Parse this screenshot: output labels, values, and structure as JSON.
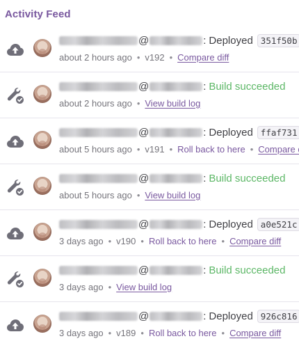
{
  "header": {
    "title": "Activity Feed"
  },
  "colors": {
    "accent": "#79589f",
    "success": "#5cb766",
    "muted": "#75747b",
    "icon": "#6f6e78"
  },
  "feed": {
    "items": [
      {
        "icon": "cloud-upload-icon",
        "user_blurred": true,
        "at": "@",
        "colon": ":",
        "action": "Deployed",
        "hash": "351f50b",
        "time": "about 2 hours ago",
        "version": "v192",
        "link1": "Compare diff",
        "link2": ""
      },
      {
        "icon": "wrench-check-icon",
        "user_blurred": true,
        "at": "@",
        "colon": ":",
        "action": "Build succeeded",
        "hash": "",
        "time": "about 2 hours ago",
        "version": "",
        "link1": "View build log",
        "link2": ""
      },
      {
        "icon": "cloud-upload-icon",
        "user_blurred": true,
        "at": "@",
        "colon": ":",
        "action": "Deployed",
        "hash": "ffaf731",
        "time": "about 5 hours ago",
        "version": "v191",
        "link1": "Roll back to here",
        "link2": "Compare diff"
      },
      {
        "icon": "wrench-check-icon",
        "user_blurred": true,
        "at": "@",
        "colon": ":",
        "action": "Build succeeded",
        "hash": "",
        "time": "about 5 hours ago",
        "version": "",
        "link1": "View build log",
        "link2": ""
      },
      {
        "icon": "cloud-upload-icon",
        "user_blurred": true,
        "at": "@",
        "colon": ":",
        "action": "Deployed",
        "hash": "a0e521c",
        "time": "3 days ago",
        "version": "v190",
        "link1": "Roll back to here",
        "link2": "Compare diff"
      },
      {
        "icon": "wrench-check-icon",
        "user_blurred": true,
        "at": "@",
        "colon": ":",
        "action": "Build succeeded",
        "hash": "",
        "time": "3 days ago",
        "version": "",
        "link1": "View build log",
        "link2": ""
      },
      {
        "icon": "cloud-upload-icon",
        "user_blurred": true,
        "at": "@",
        "colon": ":",
        "action": "Deployed",
        "hash": "926c816",
        "time": "3 days ago",
        "version": "v189",
        "link1": "Roll back to here",
        "link2": "Compare diff"
      }
    ]
  }
}
